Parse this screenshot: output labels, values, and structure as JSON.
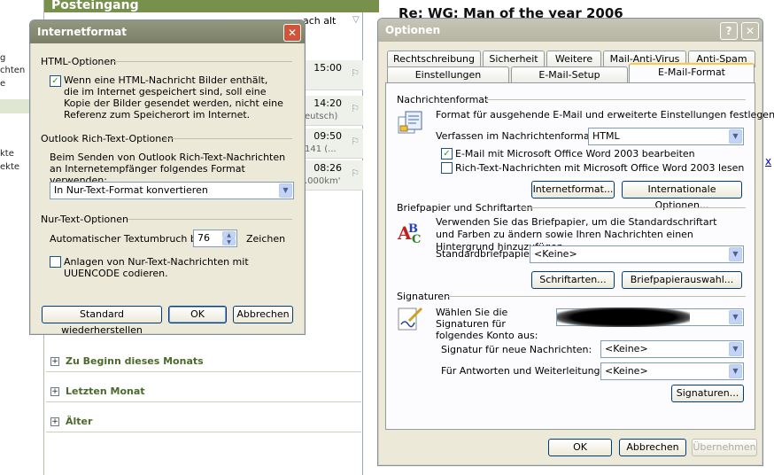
{
  "background": {
    "left_fragments": [
      "g",
      "chten",
      "e",
      "kte",
      "ekte"
    ],
    "list_header": "Posteingang",
    "list_col": "ach alt",
    "mail_rows": [
      {
        "time": "15:00",
        "snippet": ""
      },
      {
        "time": "14:20",
        "snippet": "eutsch)"
      },
      {
        "time": "09:50",
        "snippet": "141 (..."
      },
      {
        "time": "08:26",
        "snippet": ".000km'"
      }
    ],
    "groups": [
      {
        "label": "Zu Beginn dieses Monats"
      },
      {
        "label": "Letzten Monat"
      },
      {
        "label": "Älter"
      }
    ],
    "reading_title": "Re: WG: Man of the year 2006",
    "reading_link": "x"
  },
  "inet": {
    "title": "Internetformat",
    "close": "✕",
    "html_group": "HTML-Optionen",
    "html_check_label": "Wenn eine HTML-Nachricht Bilder enthält, die im Internet gespeichert sind, soll eine Kopie der Bilder gesendet werden, nicht eine Referenz zum Speicherort im Internet.",
    "html_checked": true,
    "rtf_group": "Outlook Rich-Text-Optionen",
    "rtf_desc": "Beim Senden von Outlook Rich-Text-Nachrichten an Internetempfänger folgendes Format verwenden:",
    "rtf_select": "In Nur-Text-Format konvertieren",
    "plain_group": "Nur-Text-Optionen",
    "wrap_label": "Automatischer Textumbruch bei",
    "wrap_value": "76",
    "wrap_unit": "Zeichen",
    "uuencode_label": "Anlagen von Nur-Text-Nachrichten mit UUENCODE codieren.",
    "uuencode_checked": false,
    "btn_restore": "Standard wiederherstellen",
    "btn_ok": "OK",
    "btn_cancel": "Abbrechen"
  },
  "opt": {
    "title": "Optionen",
    "help": "?",
    "close": "✕",
    "tabs_row1": [
      "Rechtschreibung",
      "Sicherheit",
      "Weitere",
      "Mail-Anti-Virus",
      "Anti-Spam"
    ],
    "tabs_row2": [
      "Einstellungen",
      "E-Mail-Setup",
      "E-Mail-Format"
    ],
    "active_tab": "E-Mail-Format",
    "msgformat_group": "Nachrichtenformat",
    "msgformat_desc": "Format für ausgehende E-Mail und erweiterte Einstellungen festlegen.",
    "compose_label": "Verfassen im Nachrichtenformat:",
    "compose_value": "HTML",
    "word_edit_label": "E-Mail mit Microsoft Office Word 2003 bearbeiten",
    "word_edit_checked": true,
    "word_read_label": "Rich-Text-Nachrichten mit Microsoft Office Word 2003 lesen",
    "word_read_checked": false,
    "btn_internetformat": "Internetformat...",
    "btn_intl": "Internationale Optionen...",
    "stationery_group": "Briefpapier und Schriftarten",
    "stationery_desc": "Verwenden Sie das Briefpapier, um die Standardschriftart und Farben zu ändern sowie Ihren Nachrichten einen Hintergrund hinzuzufügen.",
    "stationery_label": "Standardbriefpapier:",
    "stationery_value": "<Keine>",
    "btn_fonts": "Schriftarten...",
    "btn_stationery": "Briefpapierauswahl...",
    "sig_group": "Signaturen",
    "sig_desc": "Wählen Sie die Signaturen für folgendes Konto aus:",
    "sig_new_label": "Signatur für neue Nachrichten:",
    "sig_new_value": "<Keine>",
    "sig_reply_label": "Für Antworten und Weiterleitungen:",
    "sig_reply_value": "<Keine>",
    "btn_signatures": "Signaturen...",
    "btn_ok": "OK",
    "btn_cancel": "Abbrechen",
    "btn_apply": "Übernehmen"
  }
}
